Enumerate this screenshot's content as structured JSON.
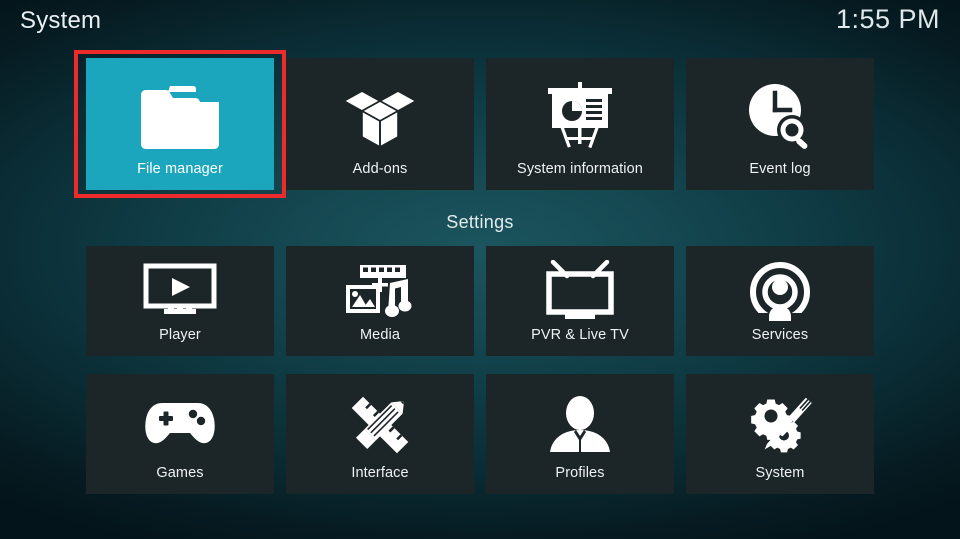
{
  "header": {
    "title": "System",
    "clock": "1:55 PM"
  },
  "sections": {
    "settings_label": "Settings"
  },
  "colors": {
    "selected_tile": "#1ba6bd",
    "tile": "#1c2528",
    "selection_outline": "#ee2b2b",
    "background": "#0f3b44",
    "icon": "#ffffff",
    "text": "#eaf0f1"
  },
  "top_row": [
    {
      "label": "File manager",
      "icon": "folder-icon",
      "selected": true
    },
    {
      "label": "Add-ons",
      "icon": "open-box-icon",
      "selected": false
    },
    {
      "label": "System information",
      "icon": "presentation-chart-icon",
      "selected": false
    },
    {
      "label": "Event log",
      "icon": "clock-search-icon",
      "selected": false
    }
  ],
  "settings_row_1": [
    {
      "label": "Player",
      "icon": "monitor-play-icon",
      "selected": false
    },
    {
      "label": "Media",
      "icon": "film-photo-music-icon",
      "selected": false
    },
    {
      "label": "PVR & Live TV",
      "icon": "tv-antenna-icon",
      "selected": false
    },
    {
      "label": "Services",
      "icon": "person-broadcast-icon",
      "selected": false
    }
  ],
  "settings_row_2": [
    {
      "label": "Games",
      "icon": "gamepad-icon",
      "selected": false
    },
    {
      "label": "Interface",
      "icon": "pencil-ruler-icon",
      "selected": false
    },
    {
      "label": "Profiles",
      "icon": "person-bust-icon",
      "selected": false
    },
    {
      "label": "System",
      "icon": "gears-screwdriver-icon",
      "selected": false
    }
  ]
}
